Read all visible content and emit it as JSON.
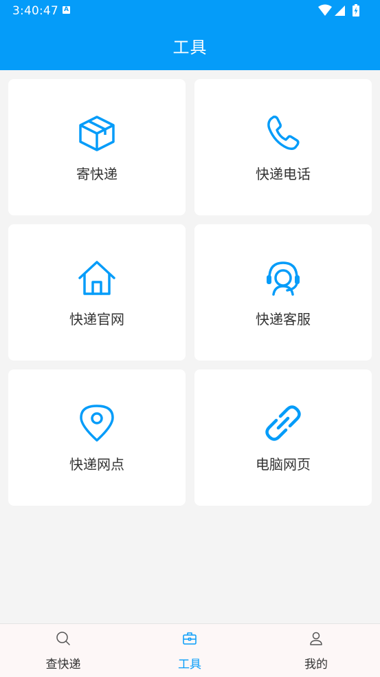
{
  "status": {
    "time": "3:40:47",
    "notif_badge": "A"
  },
  "header": {
    "title": "工具"
  },
  "tools": [
    {
      "label": "寄快递",
      "icon": "package-box-icon"
    },
    {
      "label": "快递电话",
      "icon": "phone-icon"
    },
    {
      "label": "快递官网",
      "icon": "home-icon"
    },
    {
      "label": "快递客服",
      "icon": "customer-service-headset-icon"
    },
    {
      "label": "快递网点",
      "icon": "location-pin-icon"
    },
    {
      "label": "电脑网页",
      "icon": "link-icon"
    }
  ],
  "tabs": [
    {
      "label": "查快递",
      "icon": "search-icon",
      "active": false
    },
    {
      "label": "工具",
      "icon": "toolbox-icon",
      "active": true
    },
    {
      "label": "我的",
      "icon": "user-icon",
      "active": false
    }
  ],
  "colors": {
    "accent": "#059cf9",
    "background": "#f4f4f4",
    "text": "#333333"
  }
}
